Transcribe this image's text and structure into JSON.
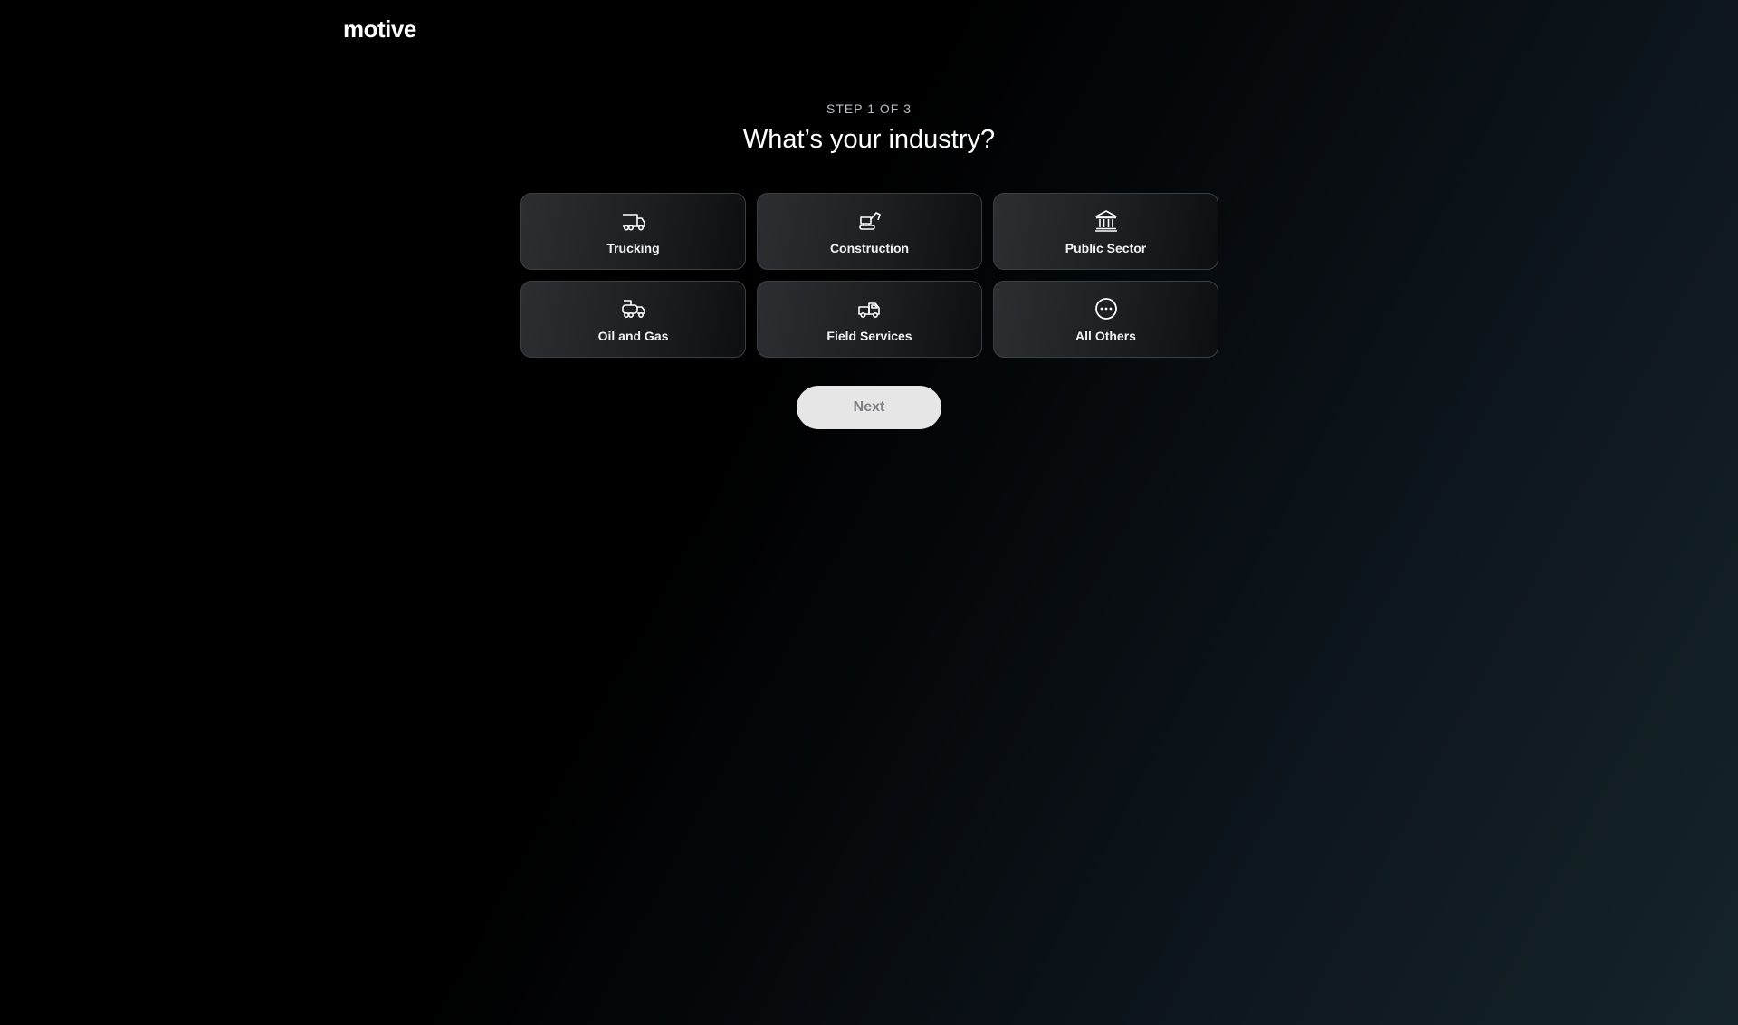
{
  "brand": {
    "logo_text": "motive"
  },
  "wizard": {
    "step_label": "STEP 1 OF 3",
    "title": "What’s your industry?",
    "options": [
      {
        "label": "Trucking",
        "icon": "truck-icon"
      },
      {
        "label": "Construction",
        "icon": "excavator-icon"
      },
      {
        "label": "Public Sector",
        "icon": "government-building-icon"
      },
      {
        "label": "Oil and Gas",
        "icon": "tanker-truck-icon"
      },
      {
        "label": "Field Services",
        "icon": "service-truck-icon"
      },
      {
        "label": "All Others",
        "icon": "more-options-icon"
      }
    ],
    "next_label": "Next"
  },
  "colors": {
    "background": "#000000",
    "card_border": "#3b3e43",
    "button_bg": "#e6e6e7",
    "button_text": "#7d7f83"
  }
}
